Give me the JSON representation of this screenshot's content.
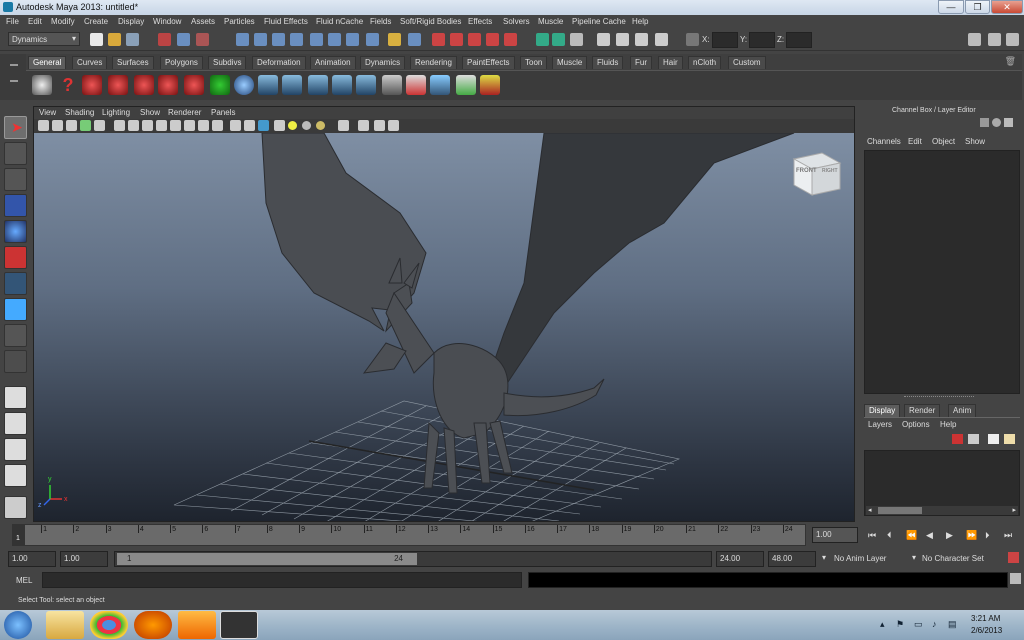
{
  "window": {
    "title": "Autodesk Maya 2013: untitled*",
    "minimize": "—",
    "maximize": "❐",
    "close": "✕"
  },
  "menubar": [
    "File",
    "Edit",
    "Modify",
    "Create",
    "Display",
    "Window",
    "Assets",
    "Particles",
    "Fluid Effects",
    "Fluid nCache",
    "Fields",
    "Soft/Rigid Bodies",
    "Effects",
    "Solvers",
    "Muscle",
    "Pipeline Cache",
    "Help"
  ],
  "statusline": {
    "menuset": "Dynamics",
    "x_label": "X:",
    "y_label": "Y:",
    "z_label": "Z:",
    "x_value": "",
    "y_value": "",
    "z_value": ""
  },
  "shelf": {
    "tabs": [
      "General",
      "Curves",
      "Surfaces",
      "Polygons",
      "Subdivs",
      "Deformation",
      "Animation",
      "Dynamics",
      "Rendering",
      "PaintEffects",
      "Toon",
      "Muscle",
      "Fluids",
      "Fur",
      "Hair",
      "nCloth",
      "Custom"
    ],
    "active_tab": "General"
  },
  "viewport": {
    "menus": [
      "View",
      "Shading",
      "Lighting",
      "Show",
      "Renderer",
      "Panels"
    ],
    "viewcube_front": "FRONT",
    "viewcube_right": "RIGHT",
    "axis_x": "x",
    "axis_y": "y",
    "axis_z": "z"
  },
  "channelbox": {
    "title": "Channel Box / Layer Editor",
    "menus": [
      "Channels",
      "Edit",
      "Object",
      "Show"
    ],
    "layer_tabs": [
      "Display",
      "Render",
      "Anim"
    ],
    "layer_menus": [
      "Layers",
      "Options",
      "Help"
    ]
  },
  "timeline": {
    "ticks": [
      "1",
      "2",
      "3",
      "4",
      "5",
      "6",
      "7",
      "8",
      "9",
      "10",
      "11",
      "12",
      "13",
      "14",
      "15",
      "16",
      "17",
      "18",
      "19",
      "20",
      "21",
      "22",
      "23",
      "24"
    ],
    "current_frame": "1.00",
    "current_marker": "1"
  },
  "range": {
    "start": "1.00",
    "playback_start": "1.00",
    "slider_left": "1",
    "slider_right": "24",
    "playback_end": "24.00",
    "end": "48.00",
    "anim_layer": "No Anim Layer",
    "character_set": "No Character Set"
  },
  "command": {
    "mel_label": "MEL"
  },
  "helpline": {
    "text": "Select Tool: select an object"
  },
  "taskbar": {
    "time": "3:21 AM",
    "date": "2/6/2013"
  },
  "colors": {
    "accent": "#4f7fb0",
    "panel": "#444444",
    "viewport_top": "#7f8fa4",
    "viewport_bottom": "#1e242e"
  }
}
